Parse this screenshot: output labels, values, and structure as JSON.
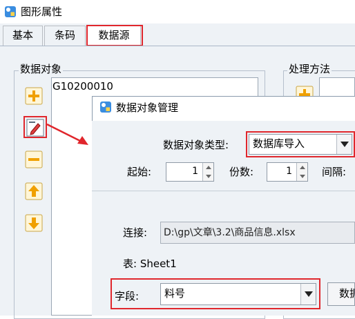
{
  "window": {
    "title": "图形属性",
    "icon": "app-shapes-icon"
  },
  "tabs": [
    {
      "label": "基本",
      "active": false
    },
    {
      "label": "条码",
      "active": false
    },
    {
      "label": "数据源",
      "active": true
    }
  ],
  "data_objects": {
    "group_label": "数据对象",
    "items": [
      "G10200010"
    ],
    "side_buttons": [
      "add-icon",
      "edit-icon",
      "remove-icon",
      "move-up-icon",
      "move-down-icon"
    ]
  },
  "processing": {
    "group_label": "处理方法",
    "button_icon": "add-icon"
  },
  "dialog": {
    "title": "数据对象管理",
    "type_label": "数据对象类型:",
    "type_value": "数据库导入",
    "start_label": "起始:",
    "start_value": "1",
    "copies_label": "份数:",
    "copies_value": "1",
    "interval_label": "间隔:",
    "connection_label": "连接:",
    "connection_value": "D:\\gp\\文章\\3.2\\商品信息.xlsx",
    "table_text": "表: Sheet1",
    "field_label": "字段:",
    "field_value": "料号",
    "data_button_label": "数据"
  },
  "colors": {
    "highlight": "#e0262c",
    "arrow": "#e0262c",
    "panel_bg": "#eef2f6"
  }
}
